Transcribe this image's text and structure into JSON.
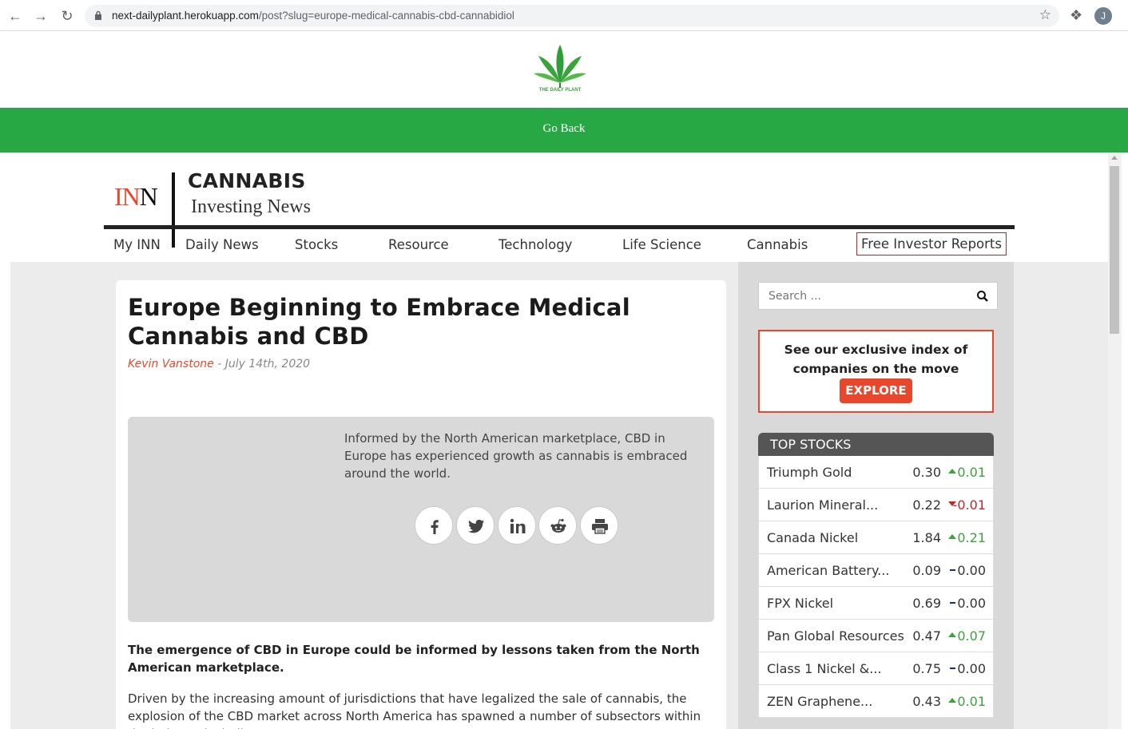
{
  "browser": {
    "url_host": "next-dailyplant.herokuapp.com",
    "url_path": "/post?slug=europe-medical-cannabis-cbd-cannabidiol",
    "profile_initial": "J"
  },
  "site": {
    "logo_text": "THE DAILY PLANT",
    "go_back": "Go Back"
  },
  "inn": {
    "logo_in": "IN",
    "logo_n": "N",
    "category": "CANNABIS",
    "subtitle": "Investing News"
  },
  "menu": [
    "My INN",
    "Daily News",
    "Stocks",
    "Resource",
    "Technology",
    "Life Science",
    "Cannabis",
    "Free Investor Reports"
  ],
  "article": {
    "title": "Europe Beginning to Embrace Medical Cannabis and CBD",
    "author": "Kevin Vanstone",
    "date": " - July 14th, 2020",
    "hero_text": "Informed by the North American marketplace, CBD in Europe has experienced growth as cannabis is embraced around the world.",
    "lead": "The emergence of CBD in Europe could be informed by lessons taken from the North American marketplace.",
    "body": "Driven by the increasing amount of jurisdictions that have legalized the sale of cannabis, the explosion of the CBD market across North America has spawned a number of subsectors within the industry including"
  },
  "sidebar": {
    "search_placeholder": "Search ...",
    "promo_text": "See our exclusive index of companies on the move",
    "explore_label": "EXPLORE",
    "stocks_title": "TOP STOCKS",
    "stocks": [
      {
        "name": "Triumph Gold",
        "price": "0.30",
        "change": "0.01",
        "dir": "up"
      },
      {
        "name": "Laurion Mineral...",
        "price": "0.22",
        "change": "-0.01",
        "dir": "down"
      },
      {
        "name": "Canada Nickel",
        "price": "1.84",
        "change": "0.21",
        "dir": "up"
      },
      {
        "name": "American Battery...",
        "price": "0.09",
        "change": "0.00",
        "dir": "flat"
      },
      {
        "name": "FPX Nickel",
        "price": "0.69",
        "change": "0.00",
        "dir": "flat"
      },
      {
        "name": "Pan Global Resources",
        "price": "0.47",
        "change": "0.07",
        "dir": "up"
      },
      {
        "name": "Class 1 Nickel &...",
        "price": "0.75",
        "change": "0.00",
        "dir": "flat"
      },
      {
        "name": "ZEN Graphene...",
        "price": "0.43",
        "change": "0.01",
        "dir": "up"
      }
    ]
  },
  "colors": {
    "green_bar": "#28a745",
    "inn_red": "#e8472b",
    "up": "#3aa33a",
    "down": "#c0272d"
  }
}
